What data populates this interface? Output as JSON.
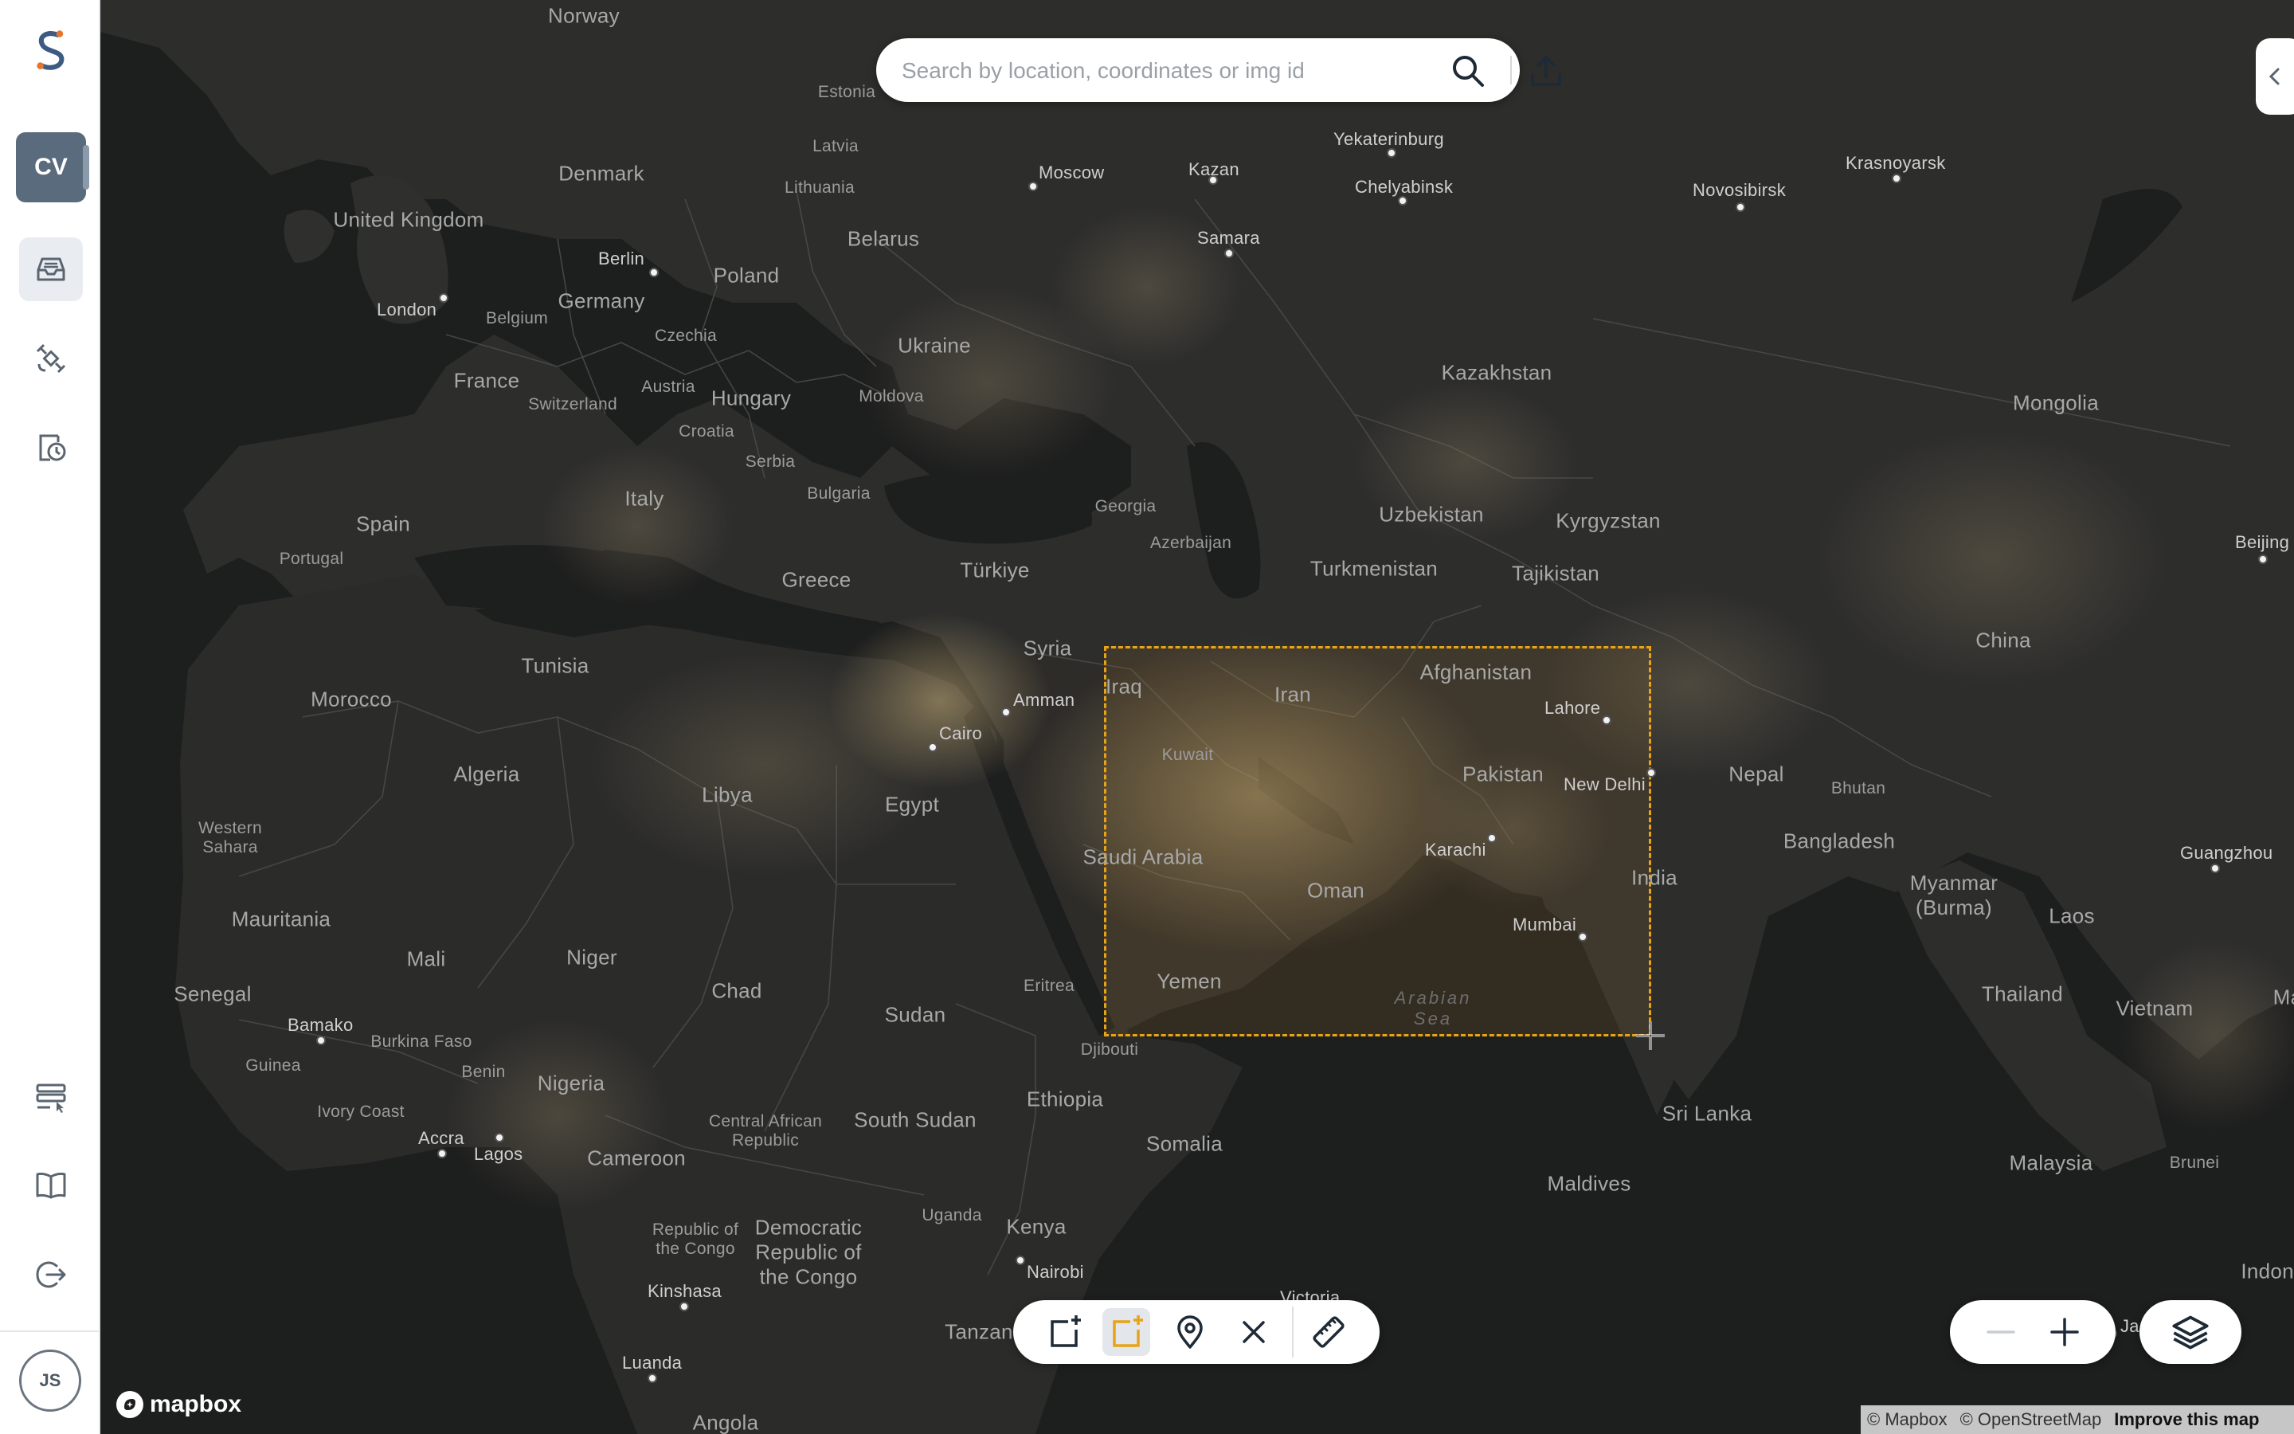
{
  "app": {
    "logo": "S",
    "project_badge": "CV",
    "user_initials": "JS",
    "accent_color": "#e8a317",
    "sidebar_icons": [
      "logo-icon",
      "inbox-icon",
      "satellite-icon",
      "clock-history-icon",
      "task-list-icon",
      "book-icon",
      "logout-icon"
    ]
  },
  "search": {
    "placeholder": "Search by location, coordinates or img id",
    "value": ""
  },
  "map": {
    "labels": {
      "norway": "Norway",
      "estonia": "Estonia",
      "latvia": "Latvia",
      "lithuania": "Lithuania",
      "denmark": "Denmark",
      "united_kingdom": "United Kingdom",
      "belarus": "Belarus",
      "poland": "Poland",
      "germany": "Germany",
      "belgium": "Belgium",
      "czechia": "Czechia",
      "ukraine": "Ukraine",
      "france": "France",
      "switzerland": "Switzerland",
      "austria": "Austria",
      "hungary": "Hungary",
      "moldova": "Moldova",
      "croatia": "Croatia",
      "serbia": "Serbia",
      "bulgaria": "Bulgaria",
      "italy": "Italy",
      "spain": "Spain",
      "portugal": "Portugal",
      "greece": "Greece",
      "turkiye": "Türkiye",
      "georgia": "Georgia",
      "azerbaijan": "Azerbaijan",
      "kazakhstan": "Kazakhstan",
      "uzbekistan": "Uzbekistan",
      "turkmenistan": "Turkmenistan",
      "kyrgyzstan": "Kyrgyzstan",
      "tajikistan": "Tajikistan",
      "mongolia": "Mongolia",
      "china": "China",
      "syria": "Syria",
      "iraq": "Iraq",
      "iran": "Iran",
      "afghanistan": "Afghanistan",
      "kuwait": "Kuwait",
      "pakistan": "Pakistan",
      "saudi_arabia": "Saudi Arabia",
      "oman": "Oman",
      "yemen": "Yemen",
      "eritrea": "Eritrea",
      "djibouti": "Djibouti",
      "ethiopia": "Ethiopia",
      "somalia": "Somalia",
      "nepal": "Nepal",
      "bhutan": "Bhutan",
      "bangladesh": "Bangladesh",
      "india": "India",
      "myanmar": "Myanmar (Burma)",
      "laos": "Laos",
      "thailand": "Thailand",
      "vietnam": "Vietnam",
      "sri_lanka": "Sri Lanka",
      "maldives": "Maldives",
      "malaysia": "Malaysia",
      "brunei": "Brunei",
      "indonesia": "Indone",
      "morocco": "Morocco",
      "tunisia": "Tunisia",
      "algeria": "Algeria",
      "libya": "Libya",
      "egypt": "Egypt",
      "western_sahara": "Western Sahara",
      "mauritania": "Mauritania",
      "mali": "Mali",
      "niger": "Niger",
      "chad": "Chad",
      "sudan": "Sudan",
      "south_sudan": "South Sudan",
      "senegal": "Senegal",
      "burkina_faso": "Burkina Faso",
      "guinea": "Guinea",
      "ivory_coast": "Ivory Coast",
      "benin": "Benin",
      "nigeria": "Nigeria",
      "cameroon": "Cameroon",
      "car": "Central African Republic",
      "roc": "Republic of the Congo",
      "drc": "Democratic Republic of the Congo",
      "uganda": "Uganda",
      "kenya": "Kenya",
      "tanzania": "Tanzan",
      "angola": "Angola",
      "arabian_sea": "Arabian Sea",
      "ma_partial": "Ma"
    },
    "cities": {
      "moscow": "Moscow",
      "kazan": "Kazan",
      "yekaterinburg": "Yekaterinburg",
      "chelyabinsk": "Chelyabinsk",
      "samara": "Samara",
      "novosibirsk": "Novosibirsk",
      "krasnoyarsk": "Krasnoyarsk",
      "berlin": "Berlin",
      "london": "London",
      "beijing": "Beijing",
      "amman": "Amman",
      "cairo": "Cairo",
      "lahore": "Lahore",
      "new_delhi": "New Delhi",
      "karachi": "Karachi",
      "mumbai": "Mumbai",
      "guangzhou": "Guangzhou",
      "bamako": "Bamako",
      "accra": "Accra",
      "lagos": "Lagos",
      "kinshasa": "Kinshasa",
      "luanda": "Luanda",
      "nairobi": "Nairobi",
      "victoria": "Victoria",
      "jakarta_partial": "Ja"
    },
    "attribution": {
      "mapbox": "© Mapbox",
      "osm": "© OpenStreetMap",
      "improve": "Improve this map"
    },
    "brand": "mapbox"
  },
  "toolbar": {
    "tools": [
      "draw-rectangle",
      "draw-rectangle-active",
      "place-marker",
      "clear",
      "measure"
    ],
    "active": "draw-rectangle-active"
  }
}
